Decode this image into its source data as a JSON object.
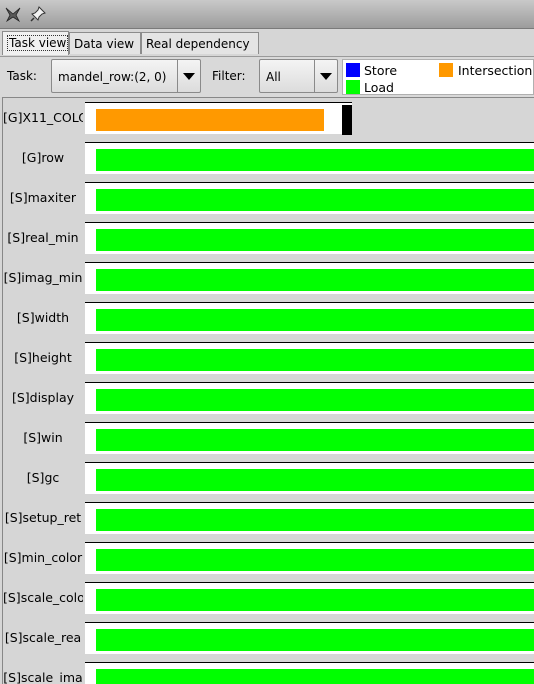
{
  "window": {
    "app_icon": "bird-icon",
    "pin_icon": "pin-icon"
  },
  "tabs": [
    {
      "label": "Task view",
      "active": true
    },
    {
      "label": "Data view",
      "active": false
    },
    {
      "label": "Real dependency",
      "active": false
    }
  ],
  "toolbar": {
    "task_label": "Task:",
    "task_value": "mandel_row:(2, 0)",
    "filter_label": "Filter:",
    "filter_value": "All"
  },
  "legend": {
    "store": {
      "label": "Store",
      "color": "#0000ff"
    },
    "intersection": {
      "label": "Intersection",
      "color": "#ff9900"
    },
    "load": {
      "label": "Load",
      "color": "#00ff00"
    }
  },
  "rows": [
    {
      "label": "[G]X11_COLO",
      "kind": "intersection",
      "fill": 0.52
    },
    {
      "label": "[G]row",
      "kind": "load",
      "fill": 1
    },
    {
      "label": "[S]maxiter",
      "kind": "load",
      "fill": 1
    },
    {
      "label": "[S]real_min",
      "kind": "load",
      "fill": 1
    },
    {
      "label": "[S]imag_min",
      "kind": "load",
      "fill": 1
    },
    {
      "label": "[S]width",
      "kind": "load",
      "fill": 1
    },
    {
      "label": "[S]height",
      "kind": "load",
      "fill": 1
    },
    {
      "label": "[S]display",
      "kind": "load",
      "fill": 1
    },
    {
      "label": "[S]win",
      "kind": "load",
      "fill": 1
    },
    {
      "label": "[S]gc",
      "kind": "load",
      "fill": 1
    },
    {
      "label": "[S]setup_ret",
      "kind": "load",
      "fill": 1
    },
    {
      "label": "[S]min_color",
      "kind": "load",
      "fill": 1
    },
    {
      "label": "[S]scale_colo",
      "kind": "load",
      "fill": 1
    },
    {
      "label": "[S]scale_rea",
      "kind": "load",
      "fill": 1
    },
    {
      "label": "[S]scale_ima",
      "kind": "load",
      "fill": 1
    }
  ]
}
